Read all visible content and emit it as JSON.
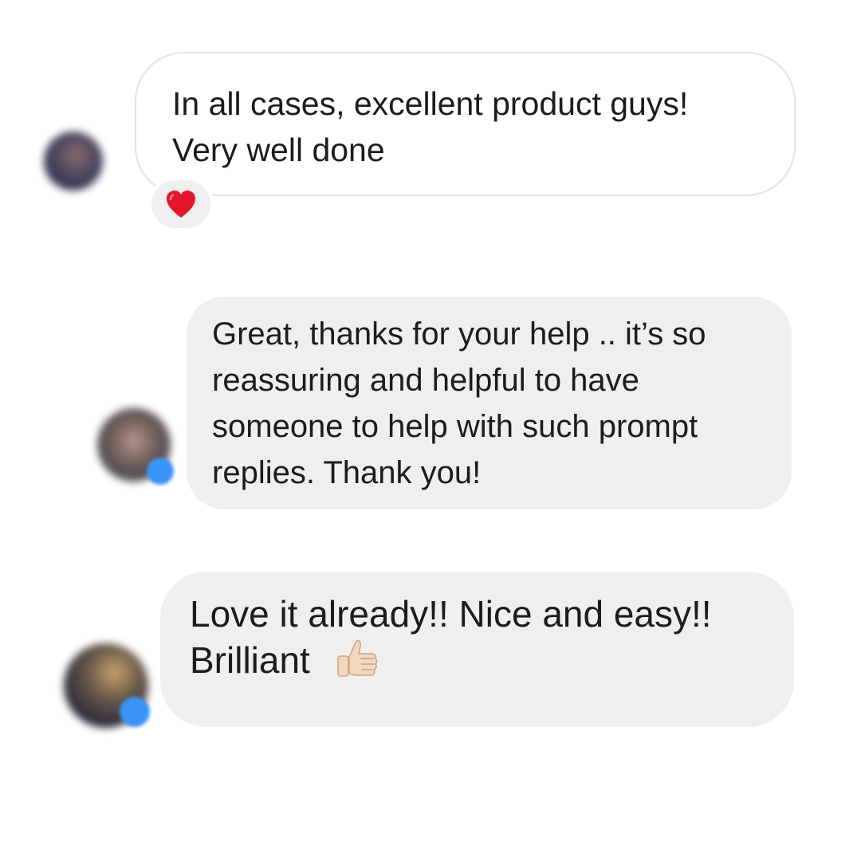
{
  "conversation": {
    "messages": [
      {
        "lines": [
          "In all cases, excellent product guys!",
          "Very well done"
        ],
        "reaction": "heart-emoji"
      },
      {
        "lines": [
          "Great, thanks for your help .. it’s so",
          "reassuring and helpful to have",
          "someone to help with such prompt",
          "replies. Thank you!"
        ]
      },
      {
        "lines": [
          "Love it already!! Nice and easy!!",
          "Brilliant"
        ],
        "emoji": "thumbs-up-emoji"
      }
    ]
  },
  "colors": {
    "bubble_background": "#efefef",
    "bubble_border": "#e3e3e6",
    "text": "#1c1c1e",
    "verified_badge": "#3b94f5",
    "heart": "#e3172b"
  }
}
